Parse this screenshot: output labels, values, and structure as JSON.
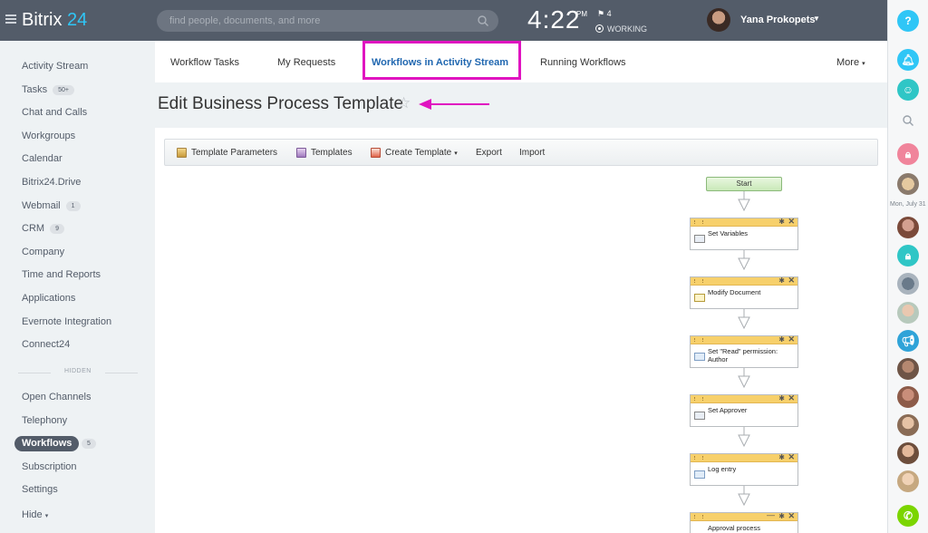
{
  "app": {
    "brand_name": "Bitrix",
    "brand_num": "24"
  },
  "header": {
    "search_placeholder": "find people, documents, and more",
    "clock": "4:22",
    "clock_period": "PM",
    "flag_count": "4",
    "status": "WORKING",
    "user_name": "Yana Prokopets"
  },
  "sidebar": {
    "items": [
      {
        "label": "Activity Stream"
      },
      {
        "label": "Tasks",
        "badge": "50+"
      },
      {
        "label": "Chat and Calls"
      },
      {
        "label": "Workgroups"
      },
      {
        "label": "Calendar"
      },
      {
        "label": "Bitrix24.Drive"
      },
      {
        "label": "Webmail",
        "badge": "1"
      },
      {
        "label": "CRM",
        "badge": "9"
      },
      {
        "label": "Company"
      },
      {
        "label": "Time and Reports"
      },
      {
        "label": "Applications"
      },
      {
        "label": "Evernote Integration"
      },
      {
        "label": "Connect24"
      }
    ],
    "hidden_label": "HIDDEN",
    "hidden_items": [
      {
        "label": "Open Channels"
      },
      {
        "label": "Telephony"
      },
      {
        "label": "Workflows",
        "badge": "5",
        "active": true
      },
      {
        "label": "Subscription"
      },
      {
        "label": "Settings"
      },
      {
        "label": "Hide"
      }
    ]
  },
  "tabs": [
    {
      "label": "Workflow Tasks"
    },
    {
      "label": "My Requests"
    },
    {
      "label": "Workflows in Activity Stream",
      "active": true
    },
    {
      "label": "Running Workflows"
    },
    {
      "label": "More"
    }
  ],
  "page": {
    "title": "Edit Business Process Template"
  },
  "toolbar": {
    "template_parameters": "Template Parameters",
    "templates": "Templates",
    "create_template": "Create Template",
    "export": "Export",
    "import": "Import"
  },
  "flow": {
    "start_label": "Start",
    "activities": [
      {
        "label": "Set Variables"
      },
      {
        "label": "Modify Document"
      },
      {
        "label": "Set \"Read\" permission: Author"
      },
      {
        "label": "Set Approver"
      },
      {
        "label": "Log entry"
      },
      {
        "label": "Approval process"
      }
    ]
  },
  "right_panel": {
    "help_label": "?",
    "date_label": "Mon, July 31"
  },
  "colors": {
    "topbar": "#535c69",
    "accent": "#2fc6f6",
    "highlight": "#e014c0",
    "activity_header": "#f7d06b"
  }
}
